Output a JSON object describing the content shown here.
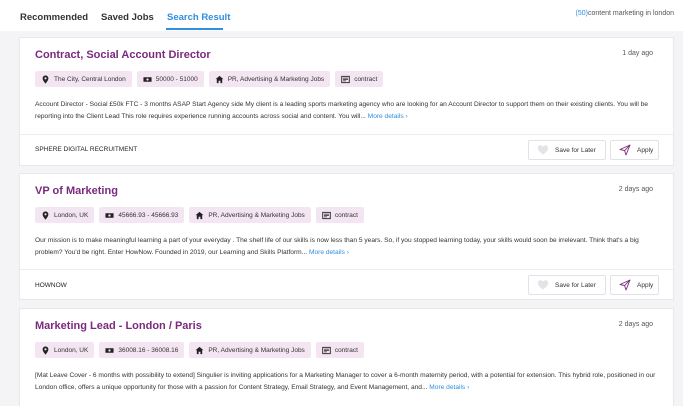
{
  "tabs": [
    {
      "label": "Recommended"
    },
    {
      "label": "Saved Jobs"
    },
    {
      "label": "Search Result"
    }
  ],
  "search_summary": {
    "count": "(50)",
    "query": "content marketing in london"
  },
  "colors": {
    "accent": "#2f8fe0",
    "title": "#7a2a7d",
    "tag_bg": "#f3e6f2"
  },
  "jobs": [
    {
      "title": "Contract, Social Account Director",
      "age": "1 day ago",
      "location": "The City, Central London",
      "salary": "50000 - 51000",
      "category": "PR, Advertising & Marketing Jobs",
      "type": "contract",
      "description": "Account Director - Social £50k FTC - 3 months ASAP Start Agency side My client is a leading sports marketing agency who are looking for an Account Director to support them on their existing clients. You will be reporting into the Client Lead This role requires experience running accounts across social and content. You will...",
      "more": "More details",
      "company": "SPHERE DIGITAL RECRUITMENT",
      "save_label": "Save for Later",
      "apply_label": "Apply"
    },
    {
      "title": "VP of Marketing",
      "age": "2 days ago",
      "location": "London, UK",
      "salary": "45666.93 - 45666.93",
      "category": "PR, Advertising & Marketing Jobs",
      "type": "contract",
      "description": "Our mission is to make meaningful learning a part of your everyday . The shelf life of our skills is now less than 5 years. So, if you stopped learning today, your skills would soon be irrelevant. Think that's a big problem? You'd be right. Enter HowNow. Founded in 2019, our Learning and Skills Platform...",
      "more": "More details",
      "company": "HOWNOW",
      "save_label": "Save for Later",
      "apply_label": "Apply"
    },
    {
      "title": "Marketing Lead - London / Paris",
      "age": "2 days ago",
      "location": "London, UK",
      "salary": "36008.16 - 36008.16",
      "category": "PR, Advertising & Marketing Jobs",
      "type": "contract",
      "description": "[Mat Leave Cover - 6 months with possibility to extend] Singulier is inviting applications for a Marketing Manager to cover a 6-month maternity period, with a potential for extension. This hybrid role, positioned in our London office, offers a unique opportunity for those with a passion for Content Strategy, Email Strategy, and Event Management, and...",
      "more": "More details",
      "company": "",
      "save_label": "",
      "apply_label": ""
    }
  ]
}
